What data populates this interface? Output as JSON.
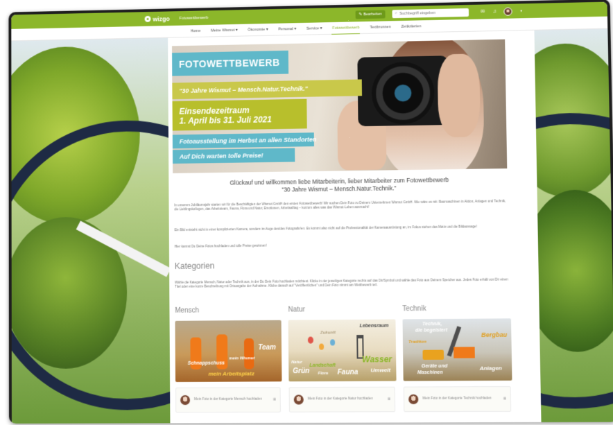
{
  "topbar": {
    "logo": "wizgo",
    "site_name": "Fotowettbewerb",
    "edit_label": "Bearbeiten",
    "search_placeholder": "Suchbegriff eingeben"
  },
  "nav": {
    "items": [
      {
        "label": "Home",
        "active": false
      },
      {
        "label": "Meine Wismut ▾",
        "active": false
      },
      {
        "label": "Ökonomie ▾",
        "active": false
      },
      {
        "label": "Personal ▾",
        "active": false
      },
      {
        "label": "Service ▾",
        "active": false
      },
      {
        "label": "Fotowettbewerb",
        "active": true
      },
      {
        "label": "Textbrunnen",
        "active": false
      },
      {
        "label": "Zeitkriterien",
        "active": false
      }
    ]
  },
  "banner": {
    "title": "FOTOWETTBEWERB",
    "subtitle": "\"30 Jahre Wismut – Mensch.Natur.Technik.\"",
    "period_label": "Einsendezeitraum",
    "period_dates": "1. April bis 31. Juli 2021",
    "exhibition": "Fotoausstellung im Herbst an allen Standorten",
    "prizes": "Auf Dich warten tolle Preise!"
  },
  "welcome": {
    "line1": "Glückauf und willkommen liebe Mitarbeiterin, lieber Mitarbeiter zum Fotowettbewerb",
    "line2": "\"30 Jahre Wismut – Mensch.Natur.Technik.\""
  },
  "intro": {
    "p1": "In unserem Jubiläumsjahr starten wir für die Beschäftigten der Wismut GmbH den ersten Fotowettbewerb! Wir suchen Dein Foto zu Deinem Unternehmen Wismut GmbH. Wie wäre es mit: Baumaschinen in Aktion, Anlagen und Technik, die Lieblingskollegen, das Arbeitsteam, Fauna, Flora und Natur, Emotionen, Arbeitsalltag – kurzum alles was das Wismut-Leben ausmacht!",
    "p2": "Ein Bild entsteht nicht in einer komplizierten Kamera, sondern im Auge des/des Fotografin/en. Es kommt also nicht auf die Professionalität der Kameraausrüstung an, im Fokus stehen das Motiv und die Bildaussage!",
    "p3": "Hier kannst Du Deine Fotos hochladen und tolle Preise gewinnen!"
  },
  "categories": {
    "heading": "Kategorien",
    "description": "Wähle die Kategorie Mensch, Natur oder Technik aus, in der Du Dein Foto hochladen möchtest. Klicke in der jeweiligen Kategorie rechts auf das Dir/Symbol und wähle das Foto aus Deinem Speicher aus. Jedes Foto erhält von Dir einen Titel oder eine kurze Beschreibung mit Ortsangabe der Aufnahme. Klicke danach auf \"Veröffentlichen\" und Dein Foto nimmt am Wettbewerb teil.",
    "columns": [
      {
        "title": "Mensch",
        "card_words": [
          "Team",
          "Schnappschuss",
          "mein Wismut",
          "mein Arbeitsplatz"
        ],
        "action": "Mein Foto in der Kategorie Mensch hochladen"
      },
      {
        "title": "Natur",
        "card_words": [
          "Lebensraum",
          "Zukunft",
          "Wasser",
          "Natur",
          "Landschaft",
          "Umwelt",
          "Grün",
          "Flora",
          "Fauna"
        ],
        "action": "Mein Foto in der Kategorie Natur hochladen"
      },
      {
        "title": "Technik",
        "card_words": [
          "Technik,",
          "die begeistert",
          "Bergbau",
          "Tradition",
          "Geräte und",
          "Maschinen",
          "Anlagen"
        ],
        "action": "Mein Foto in der Kategorie Technik hochladen"
      }
    ]
  },
  "colors": {
    "brand_green": "#8cb72a",
    "banner_teal": "#5fb8c9",
    "banner_yellow": "#b8bf2c",
    "card_orange": "#f07a1a"
  }
}
